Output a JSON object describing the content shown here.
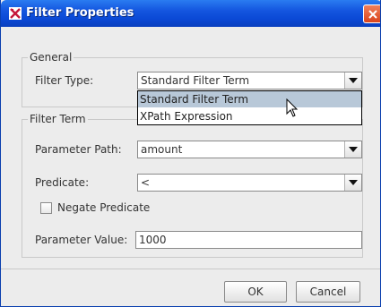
{
  "window": {
    "title": "Filter Properties"
  },
  "general": {
    "group_label": "General",
    "filter_type_label": "Filter Type:",
    "filter_type_value": "Standard Filter Term",
    "filter_type_options": [
      "Standard Filter Term",
      "XPath Expression"
    ]
  },
  "filter_term": {
    "group_label": "Filter Term",
    "parameter_path_label": "Parameter Path:",
    "parameter_path_value": "amount",
    "predicate_label": "Predicate:",
    "predicate_value": "<",
    "negate_label": "Negate Predicate",
    "negate_checked": false,
    "parameter_value_label": "Parameter Value:",
    "parameter_value": "1000"
  },
  "buttons": {
    "ok": "OK",
    "cancel": "Cancel"
  },
  "colors": {
    "titlebar": "#0b49d6",
    "close": "#d9431c",
    "selected_item": "#b8c8d8"
  }
}
